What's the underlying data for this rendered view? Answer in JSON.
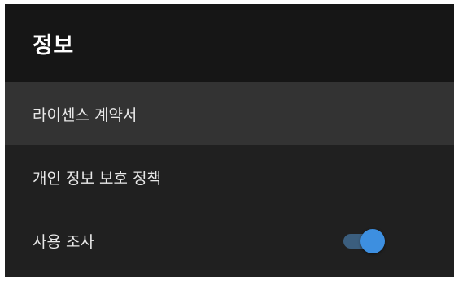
{
  "header": {
    "title": "정보"
  },
  "menu": {
    "items": [
      {
        "label": "라이센스 계약서",
        "selected": true
      },
      {
        "label": "개인 정보 보호 정책",
        "selected": false
      },
      {
        "label": "사용 조사",
        "selected": false,
        "toggle": {
          "on": true
        }
      }
    ]
  },
  "colors": {
    "panel_background": "#202020",
    "header_background": "#161616",
    "selected_row": "#333333",
    "toggle_track": "#3b5e7e",
    "toggle_thumb": "#3d8fe0"
  }
}
